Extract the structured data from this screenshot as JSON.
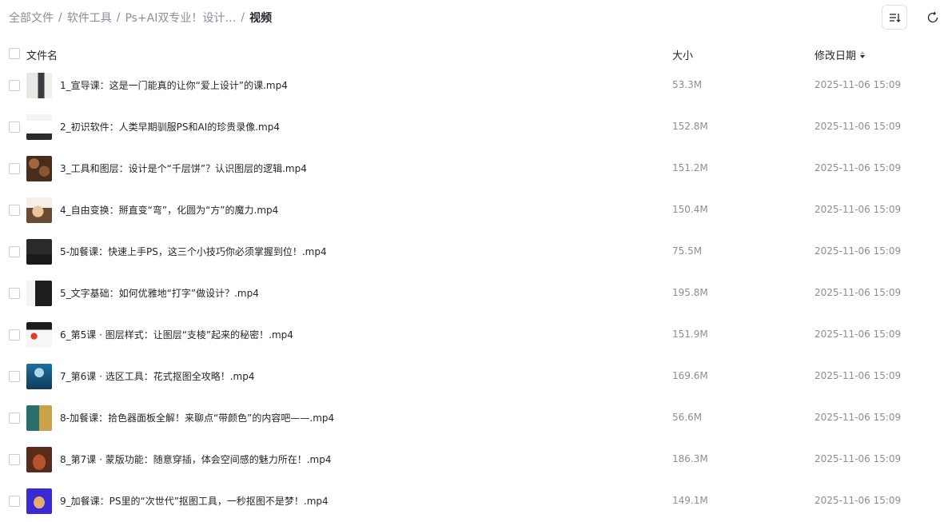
{
  "breadcrumb": {
    "items": [
      "全部文件",
      "软件工具",
      "Ps+AI双专业！设计…"
    ],
    "current": "视频",
    "separator": "/"
  },
  "toolbar": {
    "sort_icon": "sort-list-icon",
    "refresh_icon": "refresh-icon"
  },
  "table": {
    "headers": {
      "name": "文件名",
      "size": "大小",
      "date": "修改日期"
    },
    "rows": [
      {
        "name": "1_宣导课：这是一门能真的让你“爱上设计”的课.mp4",
        "size": "53.3M",
        "date": "2025-11-06 15:09",
        "thumb": "portrait-light"
      },
      {
        "name": "2_初识软件：人类早期驯服PS和AI的珍贵录像.mp4",
        "size": "152.8M",
        "date": "2025-11-06 15:09",
        "thumb": "ui-light"
      },
      {
        "name": "3_工具和图层：设计是个“千层饼”？认识图层的逻辑.mp4",
        "size": "151.2M",
        "date": "2025-11-06 15:09",
        "thumb": "coffee-beans"
      },
      {
        "name": "4_自由变换：掰直变“弯”，化圆为“方”的魔力.mp4",
        "size": "150.4M",
        "date": "2025-11-06 15:09",
        "thumb": "food-dark"
      },
      {
        "name": "5-加餐课：快速上手PS，这三个小技巧你必须掌握到位！.mp4",
        "size": "75.5M",
        "date": "2025-11-06 15:09",
        "thumb": "dark-screen"
      },
      {
        "name": "5_文字基础：如何优雅地“打字”做设计？.mp4",
        "size": "195.8M",
        "date": "2025-11-06 15:09",
        "thumb": "ui-mixed"
      },
      {
        "name": "6_第5课 · 图层样式：让图层“支棱”起来的秘密！.mp4",
        "size": "151.9M",
        "date": "2025-11-06 15:09",
        "thumb": "red-dot"
      },
      {
        "name": "7_第6课 · 选区工具：花式抠图全攻略！.mp4",
        "size": "169.6M",
        "date": "2025-11-06 15:09",
        "thumb": "blue-person"
      },
      {
        "name": "8-加餐课：拾色器面板全解！来聊点“带颜色”的内容吧——.mp4",
        "size": "56.6M",
        "date": "2025-11-06 15:09",
        "thumb": "teal-panel"
      },
      {
        "name": "8_第7课 · 蒙版功能：随意穿插，体会空间感的魅力所在！.mp4",
        "size": "186.3M",
        "date": "2025-11-06 15:09",
        "thumb": "warm-figure"
      },
      {
        "name": "9_加餐课：PS里的“次世代”抠图工具，一秒抠图不是梦！.mp4",
        "size": "149.1M",
        "date": "2025-11-06 15:09",
        "thumb": "purple-hair"
      }
    ]
  }
}
